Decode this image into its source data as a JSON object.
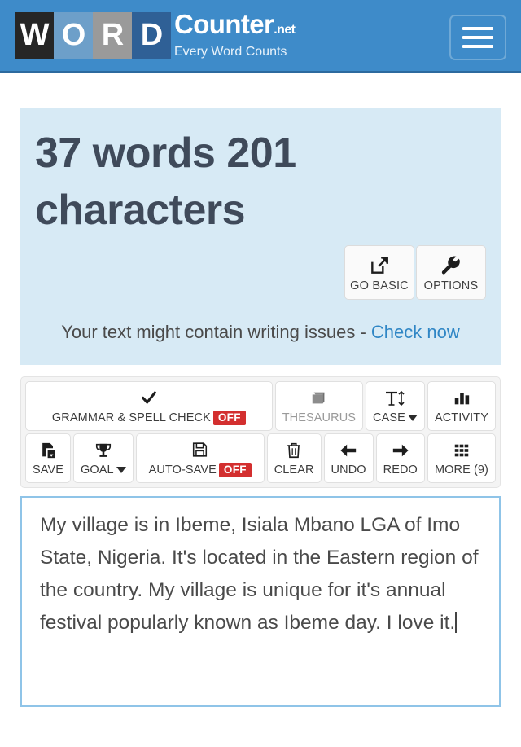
{
  "header": {
    "logo_tiles": [
      "W",
      "O",
      "R",
      "D"
    ],
    "brand": "Counter",
    "brand_suffix": ".net",
    "tagline": "Every Word Counts",
    "menu_icon": "hamburger-menu-icon",
    "bg_color": "#3e8bc9"
  },
  "stats": {
    "count_text": "37 words 201 characters",
    "word_count": 37,
    "character_count": 201,
    "bg_color": "#d7eaf5",
    "actions": [
      {
        "label": "GO BASIC",
        "icon": "external-link-icon"
      },
      {
        "label": "OPTIONS",
        "icon": "wrench-icon"
      }
    ],
    "issues_prefix": "Your text might contain writing issues - ",
    "issues_link": "Check now"
  },
  "toolbar": {
    "row1": [
      {
        "label": "GRAMMAR & SPELL CHECK",
        "icon": "checkmark-icon",
        "badge": "OFF",
        "disabled": false
      },
      {
        "label": "THESAURUS",
        "icon": "book-icon",
        "badge": "",
        "disabled": true
      },
      {
        "label": "CASE",
        "icon": "text-case-icon",
        "badge": "",
        "caret": true,
        "disabled": false
      },
      {
        "label": "ACTIVITY",
        "icon": "bar-chart-icon",
        "badge": "",
        "disabled": false
      }
    ],
    "row2": [
      {
        "label": "SAVE",
        "icon": "save-download-icon",
        "badge": "",
        "disabled": false
      },
      {
        "label": "GOAL",
        "icon": "trophy-icon",
        "badge": "",
        "caret": true,
        "disabled": false
      },
      {
        "label": "AUTO-SAVE",
        "icon": "floppy-disk-icon",
        "badge": "OFF",
        "disabled": false
      },
      {
        "label": "CLEAR",
        "icon": "trash-icon",
        "badge": "",
        "disabled": false
      },
      {
        "label": "UNDO",
        "icon": "arrow-left-icon",
        "badge": "",
        "disabled": false
      },
      {
        "label": "REDO",
        "icon": "arrow-right-icon",
        "badge": "",
        "disabled": false
      },
      {
        "label": "MORE (9)",
        "icon": "grid-icon",
        "badge": "",
        "disabled": false
      }
    ],
    "badge_color": "#d32f2f"
  },
  "editor": {
    "value": "My village is in Ibeme, Isiala Mbano LGA of Imo State, Nigeria. It's located in the Eastern region of the country. My village is unique for it's annual festival popularly known as Ibeme day. I love it.",
    "placeholder": "",
    "border_color": "#8fc4e8"
  }
}
